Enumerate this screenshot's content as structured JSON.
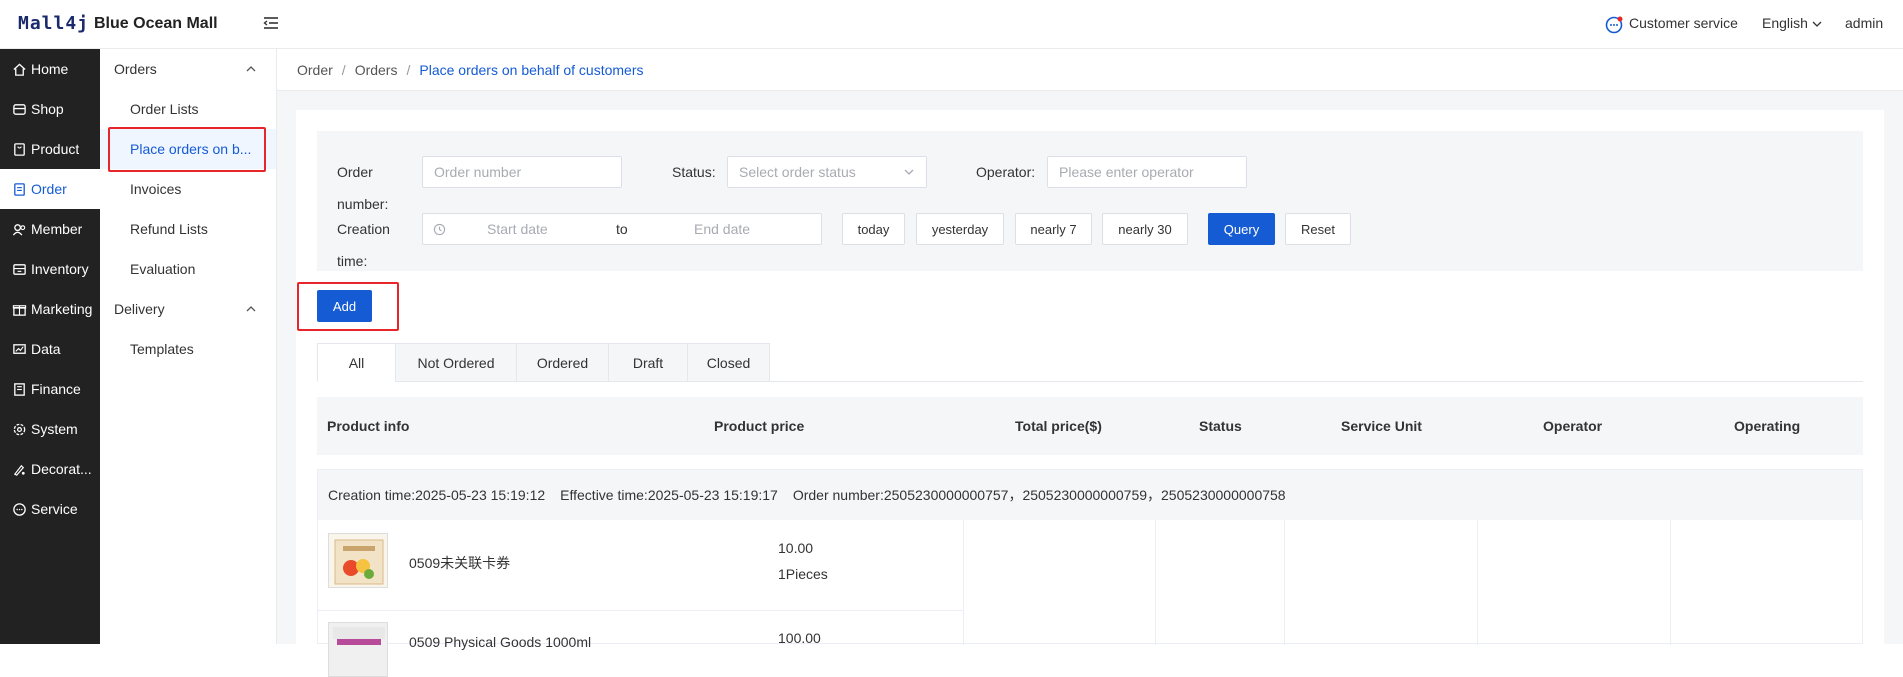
{
  "header": {
    "logo": "Mall4j",
    "app_title": "Blue Ocean Mall",
    "customer_service": "Customer service",
    "language": "English",
    "user": "admin"
  },
  "main_nav": [
    {
      "label": "Home",
      "icon": "home-icon"
    },
    {
      "label": "Shop",
      "icon": "shop-icon"
    },
    {
      "label": "Product",
      "icon": "product-icon"
    },
    {
      "label": "Order",
      "icon": "order-icon",
      "active": true
    },
    {
      "label": "Member",
      "icon": "member-icon"
    },
    {
      "label": "Inventory",
      "icon": "inventory-icon"
    },
    {
      "label": "Marketing",
      "icon": "marketing-icon"
    },
    {
      "label": "Data",
      "icon": "data-icon"
    },
    {
      "label": "Finance",
      "icon": "finance-icon"
    },
    {
      "label": "System",
      "icon": "system-icon"
    },
    {
      "label": "Decorat...",
      "icon": "decoration-icon"
    },
    {
      "label": "Service",
      "icon": "service-icon"
    }
  ],
  "sub_nav": {
    "group_orders": "Orders",
    "order_lists": "Order Lists",
    "place_orders": "Place orders on b...",
    "invoices": "Invoices",
    "refund_lists": "Refund Lists",
    "evaluation": "Evaluation",
    "group_delivery": "Delivery",
    "templates": "Templates"
  },
  "breadcrumb": [
    "Order",
    "Orders",
    "Place orders on behalf of customers"
  ],
  "filters": {
    "order_number_label_1": "Order",
    "order_number_label_2": "number:",
    "order_number_placeholder": "Order number",
    "status_label": "Status:",
    "status_placeholder": "Select order status",
    "operator_label": "Operator:",
    "operator_placeholder": "Please enter operator",
    "creation_label_1": "Creation",
    "creation_label_2": "time:",
    "start_placeholder": "Start date",
    "range_separator": "to",
    "end_placeholder": "End date",
    "btn_today": "today",
    "btn_yesterday": "yesterday",
    "btn_nearly7": "nearly 7",
    "btn_nearly30": "nearly 30",
    "btn_query": "Query",
    "btn_reset": "Reset"
  },
  "add_button": "Add",
  "tabs": [
    "All",
    "Not Ordered",
    "Ordered",
    "Draft",
    "Closed"
  ],
  "table_headers": [
    "Product info",
    "Product price",
    "Total price($)",
    "Status",
    "Service Unit",
    "Operator",
    "Operating"
  ],
  "order": {
    "creation_time": "Creation time:2025-05-23 15:19:12",
    "effective_time": "Effective time:2025-05-23 15:19:17",
    "order_numbers": "Order number:2505230000000757，2505230000000759，2505230000000758",
    "products": [
      {
        "name": "0509未关联卡券",
        "price": "10.00",
        "qty": "1Pieces"
      },
      {
        "name": "0509 Physical Goods 1000ml",
        "price": "100.00",
        "qty": ""
      }
    ]
  },
  "colors": {
    "accent": "#155bd4",
    "sidebar": "#222222",
    "highlight": "#e8262a"
  }
}
